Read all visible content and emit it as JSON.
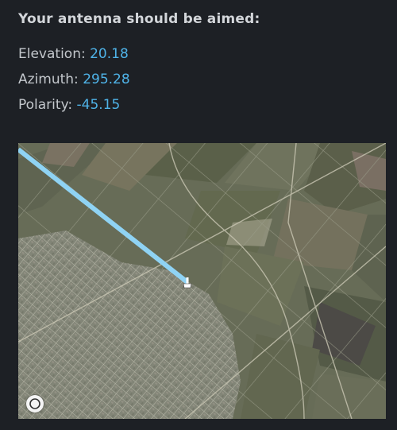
{
  "heading": "Your antenna should be aimed:",
  "readings": {
    "elevation": {
      "label": "Elevation:",
      "value": "20.18"
    },
    "azimuth": {
      "label": "Azimuth:",
      "value": "295.28"
    },
    "polarity": {
      "label": "Polarity:",
      "value": "-45.15"
    }
  },
  "colors": {
    "background": "#1d2025",
    "value_accent": "#4fb3e8",
    "beam_line": "#8fd3f4"
  },
  "map": {
    "imagery": "satellite",
    "markers": [
      "dish-marker-icon"
    ],
    "controls": [
      "compass-icon"
    ]
  }
}
